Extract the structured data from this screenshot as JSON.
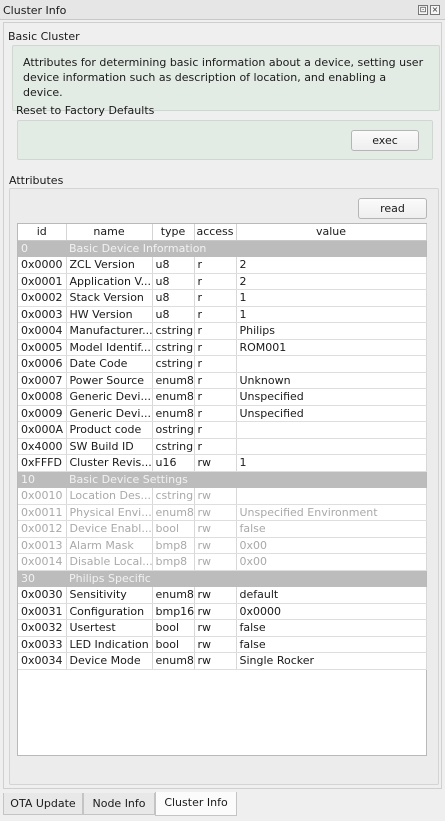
{
  "window": {
    "title": "Cluster Info",
    "float_glyph": "⊡",
    "close_glyph": "×"
  },
  "basic_cluster": {
    "heading": "Basic Cluster",
    "description": "Attributes for determining basic information about a device, setting user device information such as description of location, and enabling a device."
  },
  "reset": {
    "heading": "Reset to Factory Defaults",
    "exec_label": "exec"
  },
  "attributes": {
    "heading": "Attributes",
    "read_label": "read",
    "columns": [
      "id",
      "name",
      "type",
      "access",
      "value"
    ],
    "rows": [
      {
        "kind": "group",
        "id": "0",
        "name": "Basic Device Information"
      },
      {
        "id": "0x0000",
        "name": "ZCL Version",
        "type": "u8",
        "access": "r",
        "value": "2"
      },
      {
        "id": "0x0001",
        "name": "Application V...",
        "type": "u8",
        "access": "r",
        "value": "2"
      },
      {
        "id": "0x0002",
        "name": "Stack Version",
        "type": "u8",
        "access": "r",
        "value": "1"
      },
      {
        "id": "0x0003",
        "name": "HW Version",
        "type": "u8",
        "access": "r",
        "value": "1"
      },
      {
        "id": "0x0004",
        "name": "Manufacturer...",
        "type": "cstring",
        "access": "r",
        "value": "Philips"
      },
      {
        "id": "0x0005",
        "name": "Model Identif...",
        "type": "cstring",
        "access": "r",
        "value": "ROM001"
      },
      {
        "id": "0x0006",
        "name": "Date Code",
        "type": "cstring",
        "access": "r",
        "value": ""
      },
      {
        "id": "0x0007",
        "name": "Power Source",
        "type": "enum8",
        "access": "r",
        "value": "Unknown"
      },
      {
        "id": "0x0008",
        "name": "Generic Devi...",
        "type": "enum8",
        "access": "r",
        "value": "Unspecified"
      },
      {
        "id": "0x0009",
        "name": "Generic Devi...",
        "type": "enum8",
        "access": "r",
        "value": "Unspecified"
      },
      {
        "id": "0x000A",
        "name": "Product code",
        "type": "ostring",
        "access": "r",
        "value": ""
      },
      {
        "id": "0x4000",
        "name": "SW Build ID",
        "type": "cstring",
        "access": "r",
        "value": ""
      },
      {
        "id": "0xFFFD",
        "name": "Cluster Revis...",
        "type": "u16",
        "access": "rw",
        "value": "1"
      },
      {
        "kind": "group",
        "id": "10",
        "name": "Basic Device Settings"
      },
      {
        "kind": "disabled",
        "id": "0x0010",
        "name": "Location Des...",
        "type": "cstring",
        "access": "rw",
        "value": ""
      },
      {
        "kind": "disabled",
        "id": "0x0011",
        "name": "Physical Envi...",
        "type": "enum8",
        "access": "rw",
        "value": "Unspecified Environment"
      },
      {
        "kind": "disabled",
        "id": "0x0012",
        "name": "Device Enabl...",
        "type": "bool",
        "access": "rw",
        "value": "false"
      },
      {
        "kind": "disabled",
        "id": "0x0013",
        "name": "Alarm Mask",
        "type": "bmp8",
        "access": "rw",
        "value": "0x00"
      },
      {
        "kind": "disabled",
        "id": "0x0014",
        "name": "Disable Local...",
        "type": "bmp8",
        "access": "rw",
        "value": "0x00"
      },
      {
        "kind": "group",
        "id": "30",
        "name": "Philips Specific"
      },
      {
        "id": "0x0030",
        "name": "Sensitivity",
        "type": "enum8",
        "access": "rw",
        "value": "default"
      },
      {
        "id": "0x0031",
        "name": "Configuration",
        "type": "bmp16",
        "access": "rw",
        "value": "0x0000"
      },
      {
        "id": "0x0032",
        "name": "Usertest",
        "type": "bool",
        "access": "rw",
        "value": "false"
      },
      {
        "id": "0x0033",
        "name": "LED Indication",
        "type": "bool",
        "access": "rw",
        "value": "false"
      },
      {
        "id": "0x0034",
        "name": "Device Mode",
        "type": "enum8",
        "access": "rw",
        "value": "Single Rocker"
      }
    ]
  },
  "tabs": [
    {
      "label": "OTA Update",
      "active": false
    },
    {
      "label": "Node Info",
      "active": false
    },
    {
      "label": "Cluster Info",
      "active": true
    }
  ]
}
